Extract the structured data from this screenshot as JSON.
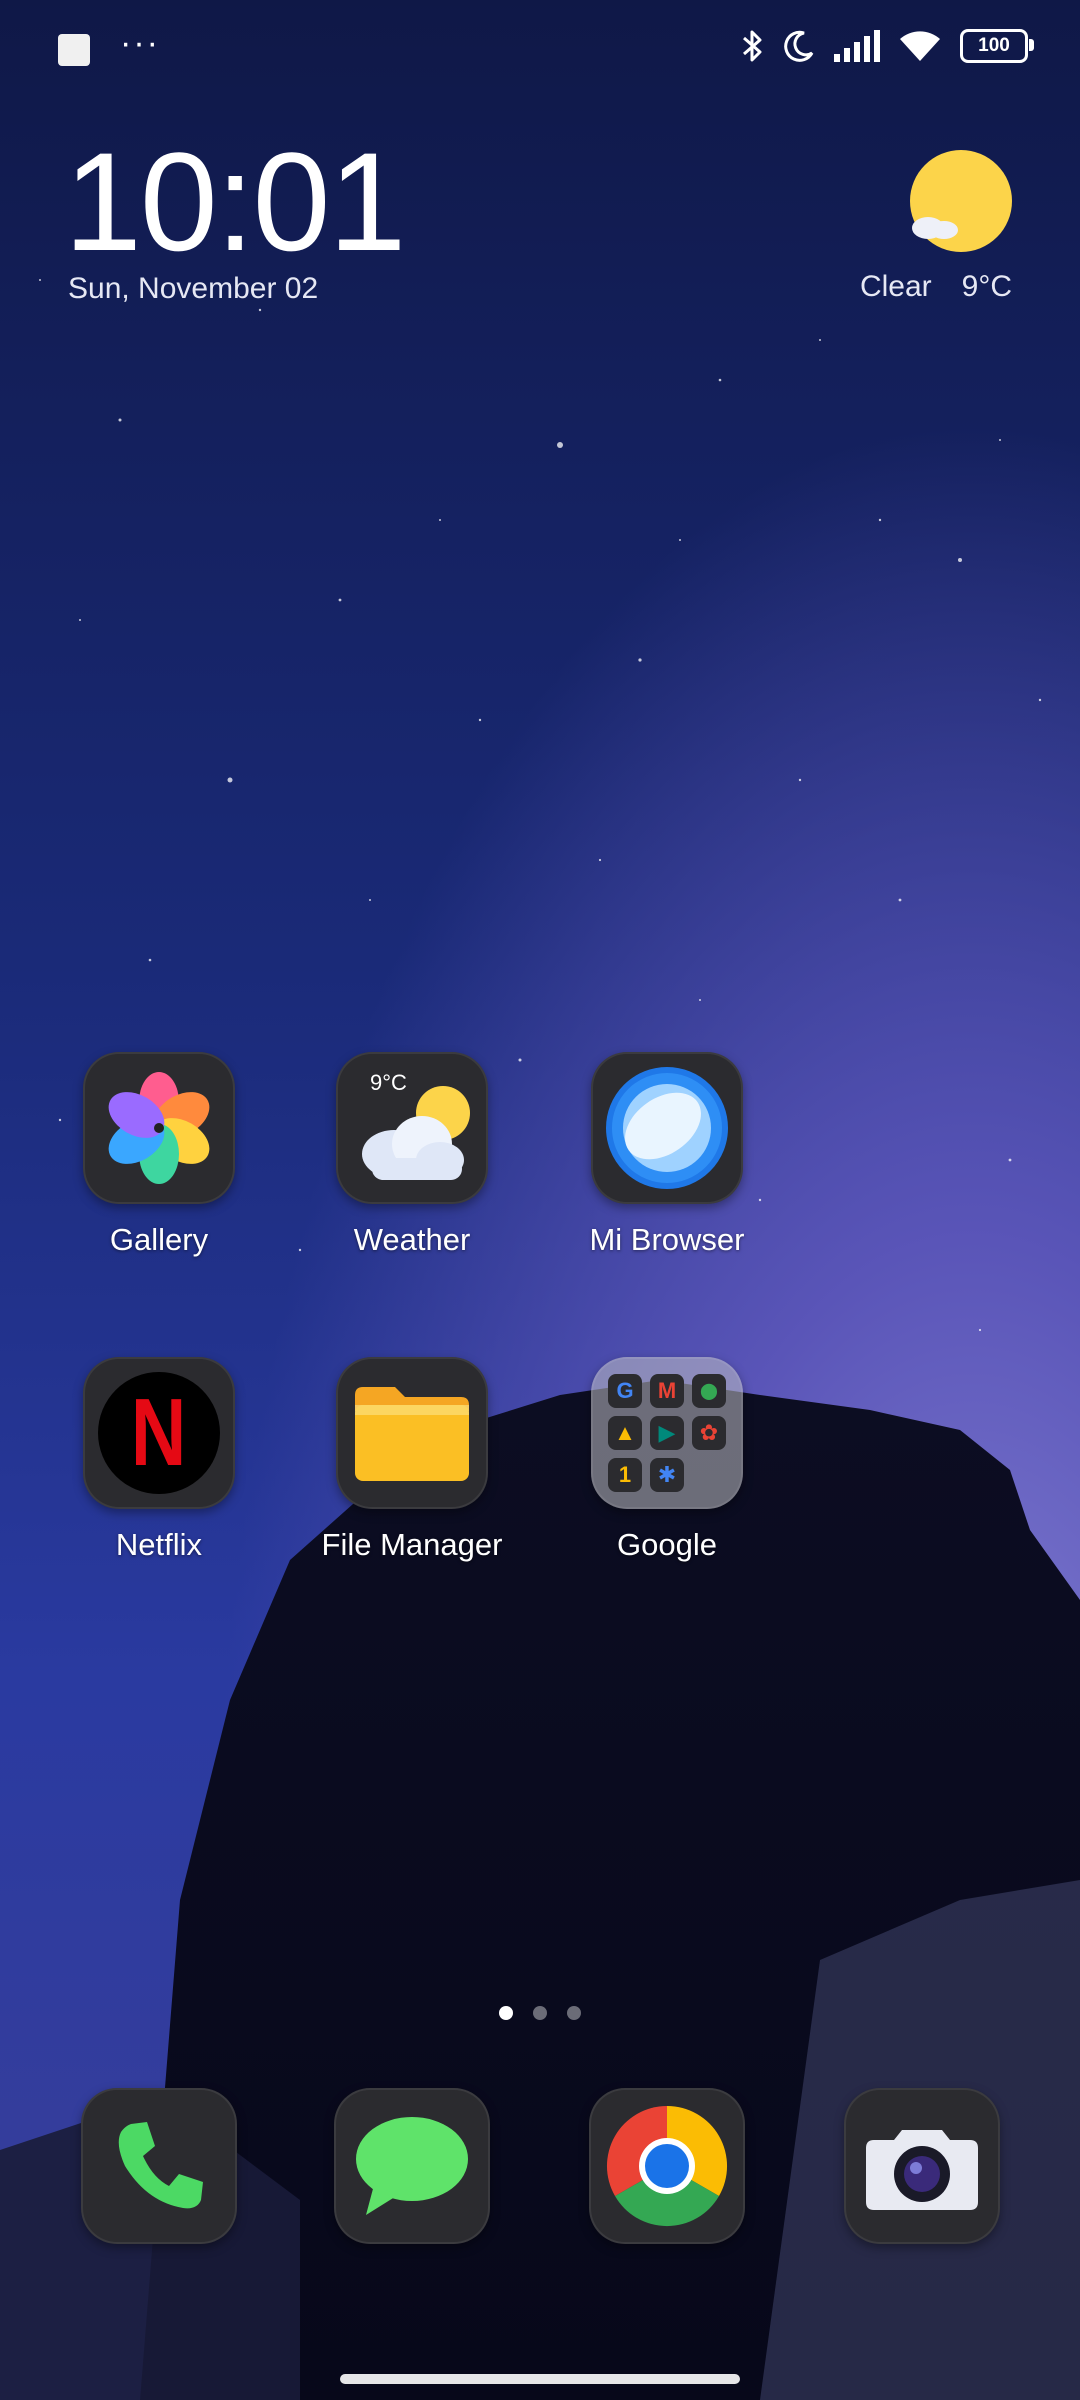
{
  "status_bar": {
    "battery": "100",
    "icons": [
      "notification-square-icon",
      "more-dots-icon",
      "bluetooth-icon",
      "moon-icon",
      "signal-icon",
      "wifi-icon",
      "battery-icon"
    ],
    "more": "···"
  },
  "clock_widget": {
    "time": "10:01",
    "date": "Sun, November 02"
  },
  "weather_widget": {
    "condition": "Clear",
    "temperature": "9°C"
  },
  "apps": [
    {
      "label": "Gallery",
      "icon": "gallery-pinwheel-icon"
    },
    {
      "label": "Weather",
      "icon": "weather-cloud-sun-icon",
      "badge": "9°C"
    },
    {
      "label": "Mi Browser",
      "icon": "browser-planet-icon"
    },
    {
      "label": "Netflix",
      "icon": "netflix-n-icon",
      "glyph": "N"
    },
    {
      "label": "File Manager",
      "icon": "folder-icon"
    },
    {
      "label": "Google",
      "icon": "google-folder-icon"
    }
  ],
  "google_folder_apps": [
    "G",
    "M",
    "⬤",
    "▲",
    "▶",
    "✿",
    "1",
    "✱"
  ],
  "pager": {
    "pages": 3,
    "active": 0
  },
  "dock": [
    {
      "name": "phone",
      "icon": "phone-icon"
    },
    {
      "name": "messages",
      "icon": "message-bubble-icon"
    },
    {
      "name": "chrome",
      "icon": "chrome-icon"
    },
    {
      "name": "camera",
      "icon": "camera-icon"
    }
  ],
  "colors": {
    "sky_top": "#0f1847",
    "sky_mid": "#2a3aa0",
    "sun": "#fcd44a",
    "netflix_red": "#e50914",
    "folder_yellow": "#fbbf24",
    "phone_green": "#4cd964"
  }
}
